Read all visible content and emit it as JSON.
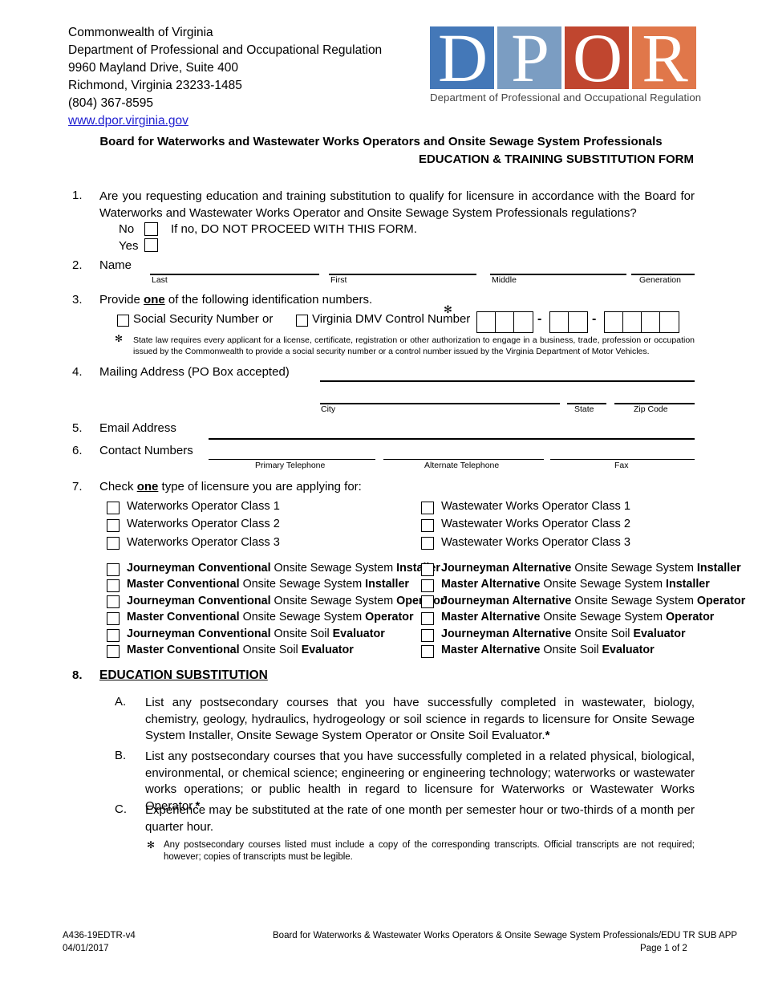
{
  "header": {
    "agency_lines": [
      "Commonwealth of Virginia",
      "Department of Professional and Occupational Regulation",
      "9960 Mayland Drive, Suite 400",
      "Richmond, Virginia 23233-1485",
      "(804) 367-8595"
    ],
    "website": "www.dpor.virginia.gov"
  },
  "logo": {
    "letters": [
      "D",
      "P",
      "O",
      "R"
    ],
    "colors": [
      "#4478b8",
      "#7b9dc2",
      "#c0462f",
      "#e0774a"
    ],
    "caption": "Department of Professional and Occupational Regulation"
  },
  "title": {
    "line1": "Board for Waterworks and Wastewater Works Operators and Onsite Sewage System Professionals",
    "line2": "EDUCATION & TRAINING SUBSTITUTION FORM"
  },
  "q1": {
    "number": "1.",
    "text": "Are you requesting education and training substitution to qualify for licensure in accordance with the Board for Waterworks and Wastewater Works Operator and Onsite Sewage System Professionals regulations?",
    "no_label": "No",
    "no_note": "If no, DO NOT PROCEED WITH THIS FORM.",
    "yes_label": "Yes"
  },
  "q2": {
    "number": "2.",
    "label": "Name",
    "captions": [
      "Last",
      "First",
      "Middle",
      "Generation"
    ]
  },
  "q3": {
    "number": "3.",
    "text_pre": "Provide ",
    "text_bold": "one",
    "text_post": " of the following identification numbers.",
    "ssn_label": "Social Security Number",
    "or_label": "or",
    "dmv_label": "Virginia DMV Control Number",
    "asterisk": "✻",
    "footnote": "State law requires every applicant for a license, certificate, registration or other authorization to engage in a business, trade, profession or occupation issued by the Commonwealth to provide a social security number or a control number issued by the Virginia Department of Motor Vehicles.",
    "box_groups": [
      3,
      2,
      4
    ],
    "separator": "-"
  },
  "q4": {
    "number": "4.",
    "label": "Mailing Address (PO Box accepted)",
    "captions": [
      "City",
      "State",
      "Zip Code"
    ]
  },
  "q5": {
    "number": "5.",
    "label": "Email Address"
  },
  "q6": {
    "number": "6.",
    "label": "Contact Numbers",
    "captions": [
      "Primary Telephone",
      "Alternate Telephone",
      "Fax"
    ]
  },
  "q7": {
    "number": "7.",
    "text_pre": "Check ",
    "text_bold": "one",
    "text_post": " type of licensure you are applying for:",
    "left_classes": [
      "Waterworks Operator Class 1",
      "Waterworks Operator Class 2",
      "Waterworks Operator Class 3"
    ],
    "right_classes": [
      "Wastewater Works Operator Class 1",
      "Wastewater Works Operator Class 2",
      "Wastewater Works Operator Class 3"
    ],
    "left_onsite": [
      {
        "a": "Journeyman Conventional",
        "b": " Onsite Sewage System ",
        "c": "Installer"
      },
      {
        "a": "Master Conventional",
        "b": " Onsite Sewage System ",
        "c": "Installer"
      },
      {
        "a": "Journeyman Conventional",
        "b": " Onsite Sewage System ",
        "c": "Operator"
      },
      {
        "a": "Master Conventional",
        "b": " Onsite Sewage System ",
        "c": "Operator"
      },
      {
        "a": "Journeyman Conventional",
        "b": " Onsite Soil ",
        "c": "Evaluator"
      },
      {
        "a": "Master Conventional",
        "b": " Onsite Soil ",
        "c": "Evaluator"
      }
    ],
    "right_onsite": [
      {
        "a": "Journeyman Alternative",
        "b": " Onsite Sewage System ",
        "c": "Installer"
      },
      {
        "a": "Master Alternative",
        "b": " Onsite Sewage System ",
        "c": "Installer"
      },
      {
        "a": "Journeyman Alternative",
        "b": " Onsite Sewage System ",
        "c": "Operator"
      },
      {
        "a": "Master Alternative",
        "b": " Onsite Sewage System ",
        "c": "Operator"
      },
      {
        "a": "Journeyman Alternative",
        "b": " Onsite Soil ",
        "c": "Evaluator"
      },
      {
        "a": "Master Alternative",
        "b": " Onsite Soil ",
        "c": "Evaluator"
      }
    ]
  },
  "q8": {
    "number": "8.",
    "heading": "EDUCATION SUBSTITUTION",
    "items": [
      {
        "letter": "A.",
        "text": "List any postsecondary courses that you have successfully completed in wastewater, biology, chemistry, geology, hydraulics, hydrogeology or soil science in regards to licensure for Onsite Sewage System Installer, Onsite Sewage System Operator or Onsite Soil Evaluator."
      },
      {
        "letter": "B.",
        "text": "List any postsecondary courses that you have successfully completed in a related physical, biological, environmental, or chemical science; engineering or engineering technology; waterworks or wastewater works operations; or public health in regard to licensure for Waterworks or Wastewater Works Operator."
      },
      {
        "letter": "C.",
        "text": "Experience may be substituted at the rate of one month per semester hour or two-thirds of a month per quarter hour."
      }
    ],
    "asterisk": "*",
    "footnote_marker": "✻",
    "footnote": "Any postsecondary courses listed must include a copy of the corresponding transcripts. Official transcripts are not required; however; copies of transcripts must be legible."
  },
  "footer": {
    "form_code": "A436-19EDTR-v4",
    "date": "04/01/2017",
    "center": "Board for Waterworks & Wastewater Works Operators & Onsite Sewage System Professionals/EDU TR SUB APP",
    "page": "Page 1 of 2"
  }
}
